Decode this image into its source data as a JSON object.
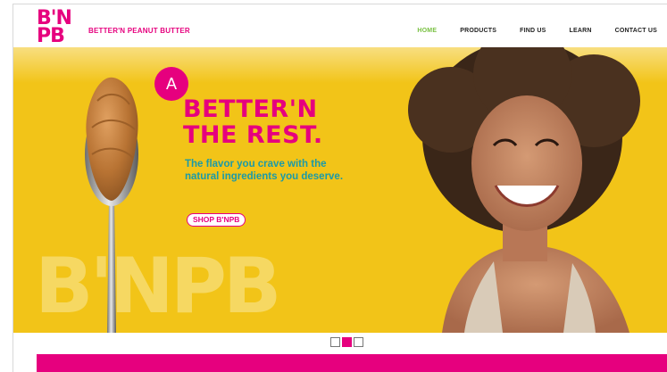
{
  "header": {
    "logo_top": "B'N",
    "logo_bottom": "PB",
    "brand_name": "BETTER'N PEANUT BUTTER",
    "nav": [
      {
        "label": "HOME",
        "active": true
      },
      {
        "label": "PRODUCTS",
        "active": false
      },
      {
        "label": "FIND US",
        "active": false
      },
      {
        "label": "LEARN",
        "active": false
      },
      {
        "label": "CONTACT US",
        "active": false
      }
    ]
  },
  "hero": {
    "badge": "A",
    "headline_1": "BETTER'N",
    "headline_2": "THE REST.",
    "subtext": "The flavor you crave with the natural ingredients you deserve.",
    "cta": "SHOP B'NPB",
    "watermark": "B'NPB",
    "background_color": "#f2c418"
  },
  "carousel": {
    "slide_count": 3,
    "active_index": 1
  },
  "colors": {
    "brand_pink": "#e6007e",
    "nav_active": "#7ac143",
    "teal": "#1b9aa8"
  }
}
